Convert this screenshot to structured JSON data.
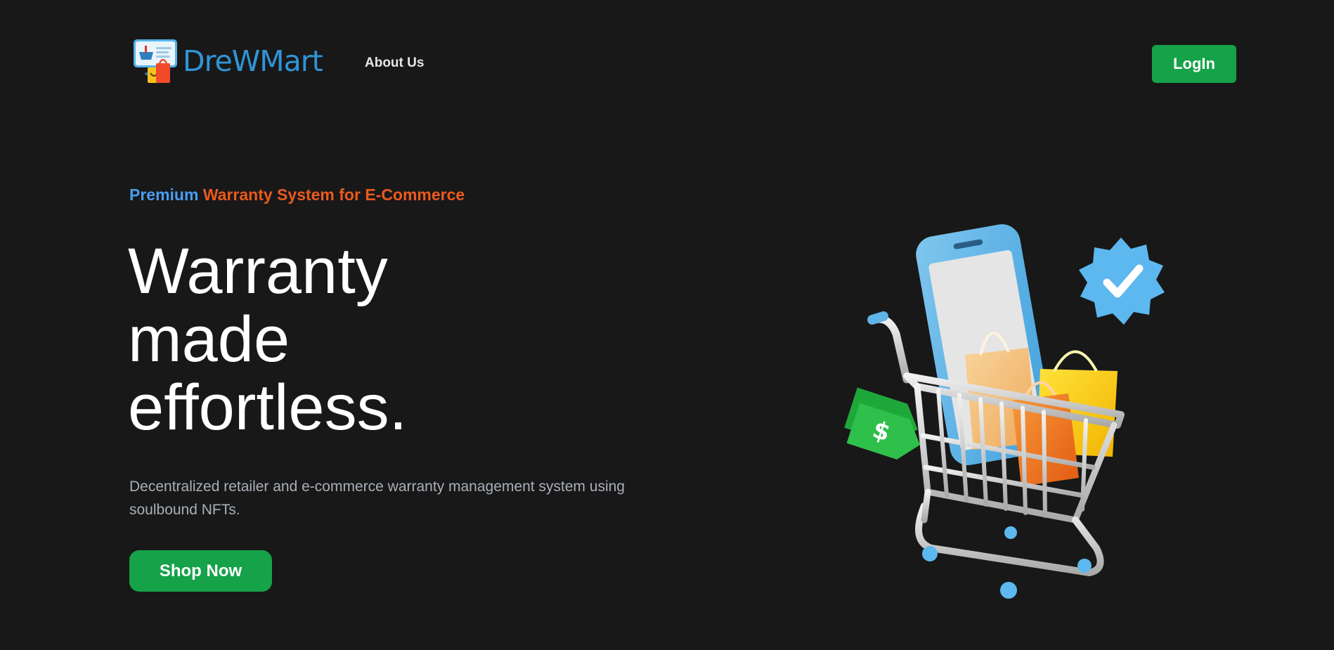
{
  "nav": {
    "brand_name": "DreWMart",
    "links": [
      {
        "label": "About Us"
      }
    ],
    "login_label": "LogIn"
  },
  "hero": {
    "eyebrow_blue": "Premium",
    "eyebrow_orange": "Warranty System for E-Commerce",
    "title_lines": [
      "Warranty",
      "made",
      "effortless."
    ],
    "description": "Decentralized retailer and e-commerce warranty management system using soulbound NFTs.",
    "cta_label": "Shop Now"
  },
  "colors": {
    "background": "#181818",
    "brand_blue": "#2f95d6",
    "accent_blue": "#4a9cf0",
    "accent_orange": "#ea5a1e",
    "button_green": "#16a249",
    "muted_text": "#a9afb8"
  },
  "icons": {
    "logo": "shop-logo-icon",
    "illustration": "shopping-cart-illustration"
  }
}
